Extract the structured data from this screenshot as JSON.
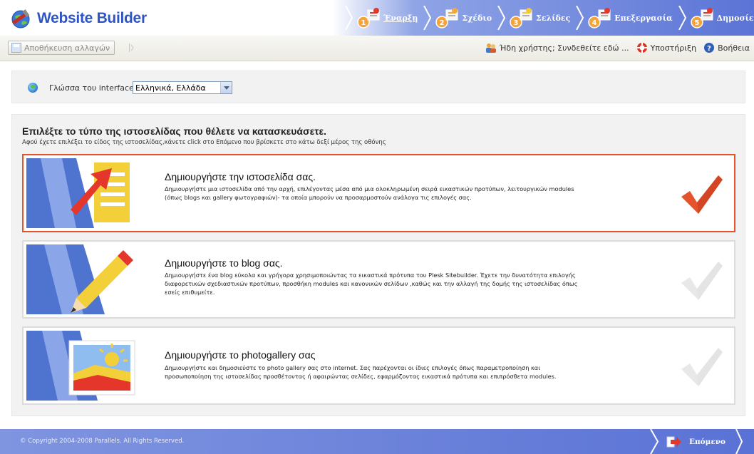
{
  "app": {
    "logo_text": "Website Builder",
    "brand_color": "#2f55c4",
    "accent_color": "#e5532d"
  },
  "steps": [
    {
      "num": "1",
      "label": "Έναρξη",
      "icon": "start-icon",
      "active": true
    },
    {
      "num": "2",
      "label": "Σχέδιο",
      "icon": "design-icon",
      "active": false
    },
    {
      "num": "3",
      "label": "Σελίδες",
      "icon": "pages-icon",
      "active": false
    },
    {
      "num": "4",
      "label": "Επεξεργασία",
      "icon": "edit-icon",
      "active": false
    },
    {
      "num": "5",
      "label": "Δημοσίευση",
      "icon": "publish-icon",
      "active": false
    }
  ],
  "toolbar": {
    "save_label": "Αποθήκευση αλλαγών",
    "login_label": "Ήδη χρήστης; Συνδεθείτε εδώ ...",
    "support_label": "Υποστήριξη",
    "help_label": "Βοήθεια"
  },
  "language": {
    "label": "Γλώσσα του interface",
    "selected": "Ελληνικά, Ελλάδα"
  },
  "main": {
    "title": "Επιλέξτε το τύπο της ιστοσελίδας που θέλετε να κατασκευάσετε.",
    "subtitle": "Αφού έχετε επιλέξει το είδος της ιστοσελίδας,κάνετε click στο Επόμενο που βρίσκετε στο κάτω δεξί μέρος της οθόνης",
    "options": [
      {
        "title": "Δημιουργήστε την ιστοσελίδα σας.",
        "line1": "Δημιουργήστε μια ιστοσελίδα από την αρχή, επιλέγοντας μέσα από μια ολοκληρωμένη σειρά εικαστικών προτύπων, λειτουργικών modules",
        "line2": "(όπως blogs και gallery φωτογραφιών)- τα οποία μπορούν να προσαρμοστούν ανάλογα τις επιλογές σας.",
        "line3": "",
        "selected": true
      },
      {
        "title": "Δημιουργήστε το blog σας.",
        "line1": "Δημιουργήστε ένα blog εύκολα και γρήγορα χρησιμοποιώντας τα εικαστικά πρότυπα του Plesk Sitebuilder. Έχετε την δυνατότητα επιλογής",
        "line2": "διαφορετικών σχεδιαστικών προτύπων, προσθήκη modules και κανονικών σελίδων ,καθώς και την αλλαγή της δομής της ιστοσελίδας όπως",
        "line3": "εσείς επιθυμείτε.",
        "selected": false
      },
      {
        "title": "Δημιουργήστε το photogallery σας",
        "line1": "Δημιουργήστε και δημοσιεύστε το photo gallery σας στο internet. Σας παρέχονται οι ίδιες επιλογές όπως παραμετροποίηση και",
        "line2": "προσωποποίηση της ιστοσελίδας προσθέτοντας ή αφαιρώντας σελίδες, εφαρμόζοντας εικαστικά πρότυπα και επιπρόσθετα modules.",
        "line3": "",
        "selected": false
      }
    ]
  },
  "footer": {
    "copyright": "© Copyright 2004-2008 Parallels. All Rights Reserved.",
    "next_label": "Επόμενο"
  }
}
